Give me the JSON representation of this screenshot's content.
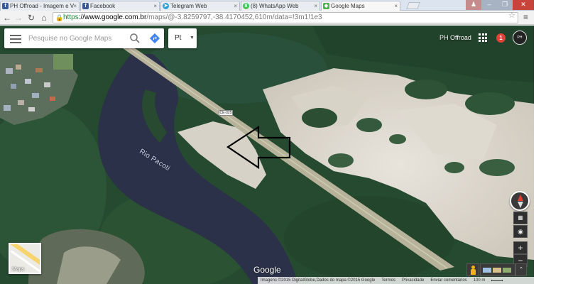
{
  "browser": {
    "tabs": [
      {
        "title": "PH Offroad - Imagem e V",
        "icon": "facebook-icon",
        "icon_letter": "f",
        "color": "#3b5998"
      },
      {
        "title": "Facebook",
        "icon": "facebook-icon",
        "icon_letter": "f",
        "color": "#3b5998"
      },
      {
        "title": "Telegram Web",
        "icon": "telegram-icon",
        "icon_letter": "➤",
        "color": "#2ea0d6"
      },
      {
        "title": "(8) WhatsApp Web",
        "icon": "whatsapp-icon",
        "icon_letter": "8",
        "color": "#43c553"
      },
      {
        "title": "Google Maps",
        "icon": "google-maps-icon",
        "icon_letter": "◆",
        "color": "#4caf50"
      }
    ],
    "close_glyph": "×",
    "url_scheme": "https",
    "url_host": "://www.google.com.br",
    "url_path": "/maps/@-3.8259797,-38.4170452,610m/data=!3m1!1e3"
  },
  "map": {
    "search_placeholder": "Pesquise no Google Maps",
    "language": "Pt",
    "account_name": "PH Offroad",
    "notifications_count": "1",
    "river_label": "Rio Pacoti",
    "road_sign": "CE-025",
    "logo_text": "Google",
    "thumbnail_label": "Maps",
    "footer": {
      "attribution": "Imagens ©2015 DigitalGlobe,Dados do mapa ©2015 Google",
      "terms": "Termos",
      "privacy": "Privacidade",
      "feedback": "Enviar comentários",
      "scale": "100 m"
    }
  },
  "colors": {
    "accent_blue": "#1a73e8",
    "notif_red": "#db4437",
    "https_green": "#1c8a3a"
  }
}
